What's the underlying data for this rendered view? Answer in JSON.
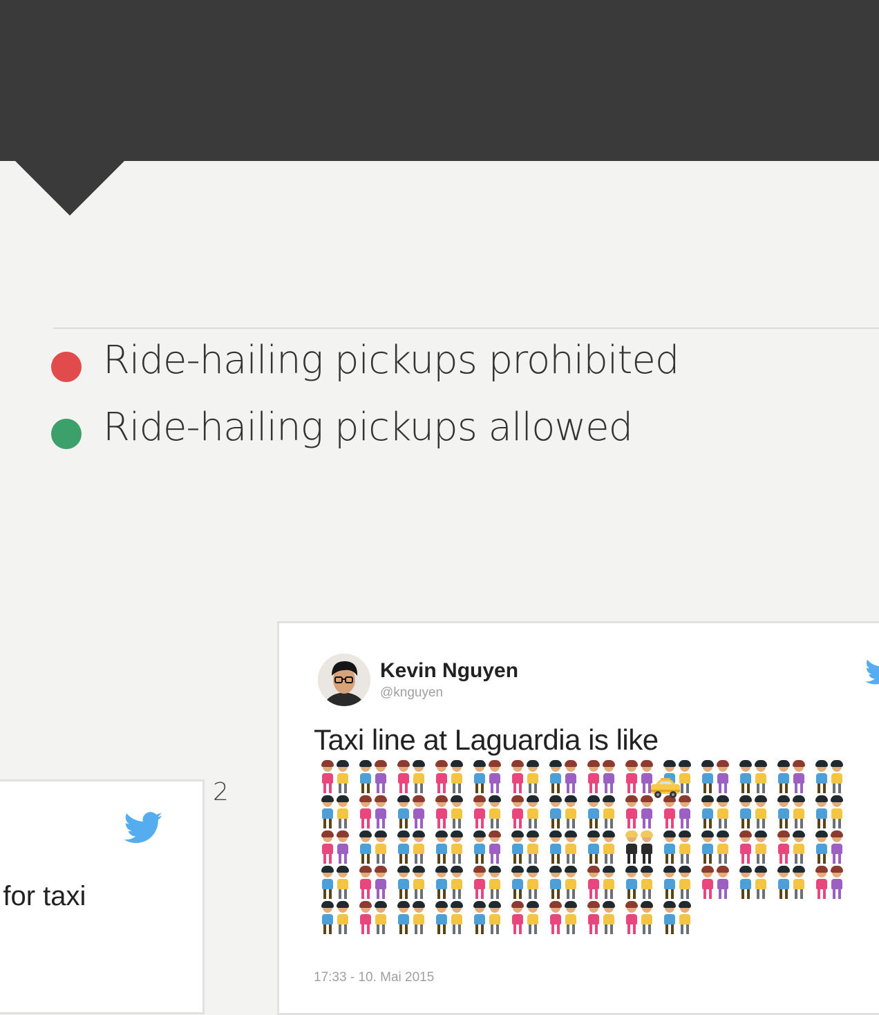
{
  "header": {
    "background": "#3a3a3a"
  },
  "legend": {
    "items": [
      {
        "label": "Ride-hailing pickups prohibited",
        "color": "#e24b4b"
      },
      {
        "label": "Ride-hailing pickups allowed",
        "color": "#3ba06a"
      }
    ]
  },
  "page_number": "2",
  "tweet_left": {
    "text_fragment": "e for taxi",
    "icon": "twitter-bird-icon"
  },
  "tweet_right": {
    "author_name": "Kevin Nguyen",
    "author_handle": "@knguyen",
    "text": "Taxi line at Laguardia is like",
    "timestamp": "17:33 - 10. Mai 2015",
    "icon": "twitter-bird-icon",
    "emoji": {
      "rows": [
        "fmmffmfmmffmmfffffmmmfmmmfmm",
        "mmffmffmfmfmmmmmffffmmmmmmmm",
        "ffmmmmmmmfmmmmmmbbmmmmfmfmmf",
        "mmffmmmmfmmmmmfmmmmmffmmmmff",
        "mmfmmmmmmmfmfmfmfmmm"
      ],
      "taxi": "taxi-icon"
    }
  }
}
